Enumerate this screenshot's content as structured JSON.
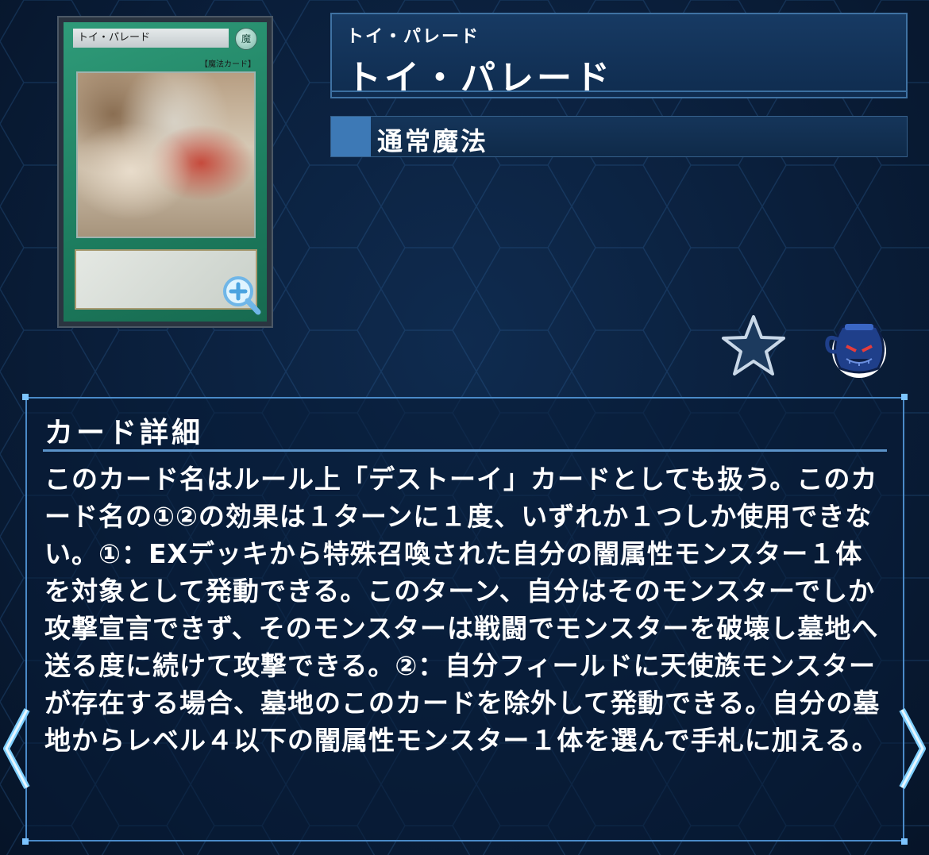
{
  "card_image": {
    "name": "トイ・パレード",
    "attribute_glyph": "魔",
    "type_line": "【魔法カード】"
  },
  "header": {
    "ruby": "トイ・パレード",
    "title": "トイ・パレード"
  },
  "type_bar": {
    "label": "通常魔法"
  },
  "detail": {
    "heading": "カード詳細",
    "text": "このカード名はルール上「デストーイ」カードとしても扱う。このカード名の①②の効果は１ターンに１度、いずれか１つしか使用できない。①：EXデッキから特殊召喚された自分の闇属性モンスター１体を対象として発動できる。このターン、自分はそのモンスターでしか攻撃宣言できず、そのモンスターは戦闘でモンスターを破壊し墓地へ送る度に続けて攻撃できる。②：自分フィールドに天使族モンスターが存在する場合、墓地のこのカードを除外して発動できる。自分の墓地からレベル４以下の闇属性モンスター１体を選んで手札に加える。"
  },
  "icons": {
    "zoom": "zoom-in-icon",
    "favorite": "star-icon",
    "pot": "pot-of-greed-icon",
    "prev": "chevron-left-icon",
    "next": "chevron-right-icon"
  },
  "colors": {
    "accent": "#3d79b6",
    "background": "#0a1e3a",
    "border": "#4a8ac8",
    "card_frame": "#1d7d5f"
  }
}
